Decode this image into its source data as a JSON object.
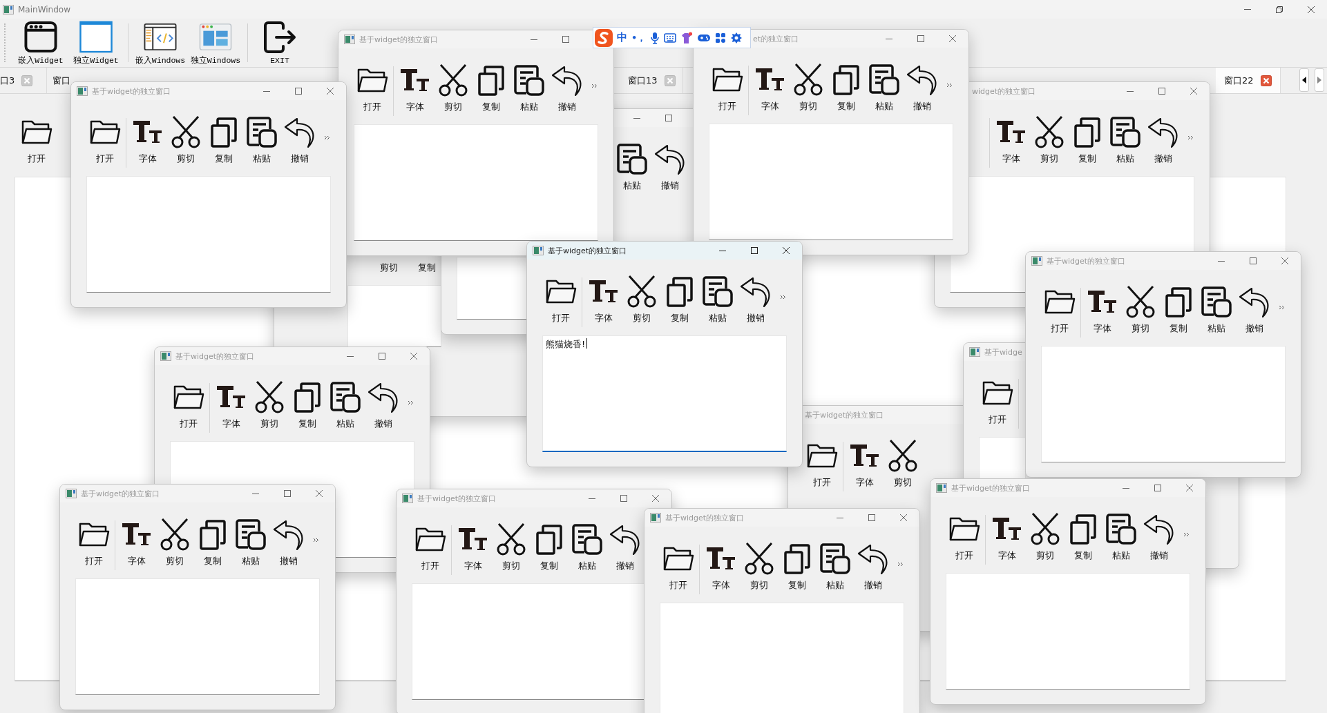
{
  "main_window": {
    "title": "MainWindow"
  },
  "toolbar": [
    {
      "kind": "embed_widget",
      "label": "嵌入Widget"
    },
    {
      "kind": "float_widget",
      "label": "独立Widget"
    },
    {
      "kind": "embed_windows",
      "label": "嵌入Windows"
    },
    {
      "kind": "float_windows",
      "label": "独立Windows"
    },
    {
      "kind": "exit",
      "label": "EXIT"
    }
  ],
  "tabs": [
    {
      "label": "口3",
      "selected": false
    },
    {
      "label": "窗口",
      "selected": false
    },
    {
      "label": "窗口13",
      "selected": false
    },
    {
      "label": "窗口22",
      "selected": true
    }
  ],
  "embedded_toolbar": [
    {
      "kind": "open",
      "label": "打开"
    }
  ],
  "windows": [
    {
      "title": "基于widget的独立窗口",
      "active": false,
      "tools": [
        {
          "kind": "open",
          "label": "打开"
        },
        {
          "kind": "font",
          "label": "字体"
        },
        {
          "kind": "cut",
          "label": "剪切"
        },
        {
          "kind": "copy",
          "label": "复制"
        },
        {
          "kind": "paste",
          "label": "粘贴"
        },
        {
          "kind": "undo",
          "label": "撤销"
        }
      ]
    },
    {
      "title": "et的独立窗口",
      "active": false,
      "tools": [
        {
          "kind": "open",
          "label": "打开"
        },
        {
          "kind": "font",
          "label": "字体"
        },
        {
          "kind": "cut",
          "label": "剪切"
        },
        {
          "kind": "copy",
          "label": "复制"
        },
        {
          "kind": "paste",
          "label": "粘贴"
        },
        {
          "kind": "undo",
          "label": "撤销"
        }
      ]
    },
    {
      "title": "基于widget的独立窗口",
      "active": false,
      "tools": [
        {
          "kind": "open",
          "label": "打开"
        },
        {
          "kind": "font",
          "label": "字体"
        },
        {
          "kind": "cut",
          "label": "剪切"
        },
        {
          "kind": "copy",
          "label": "复制"
        },
        {
          "kind": "paste",
          "label": "粘贴"
        },
        {
          "kind": "undo",
          "label": "撤销"
        }
      ]
    },
    {
      "active": false,
      "tools": [
        {
          "kind": "paste",
          "label": "粘贴"
        },
        {
          "kind": "undo",
          "label": "撤销"
        }
      ]
    },
    {
      "title": "widget的独立窗口",
      "active": false,
      "tools": [
        {
          "kind": "font",
          "label": "字体"
        },
        {
          "kind": "cut",
          "label": "剪切"
        },
        {
          "kind": "copy",
          "label": "复制"
        },
        {
          "kind": "paste",
          "label": "粘贴"
        },
        {
          "kind": "undo",
          "label": "撤销"
        }
      ]
    },
    {
      "active": false,
      "tools": [
        {
          "kind": "cut",
          "label": "剪切"
        },
        {
          "kind": "copy",
          "label": "复制"
        }
      ]
    },
    {
      "title": "基于widget的独立窗口",
      "active": true,
      "text": "熊猫烧香!",
      "tools": [
        {
          "kind": "open",
          "label": "打开"
        },
        {
          "kind": "font",
          "label": "字体"
        },
        {
          "kind": "cut",
          "label": "剪切"
        },
        {
          "kind": "copy",
          "label": "复制"
        },
        {
          "kind": "paste",
          "label": "粘贴"
        },
        {
          "kind": "undo",
          "label": "撤销"
        }
      ]
    },
    {
      "title": "基于widget的独立窗口",
      "active": false,
      "tools": [
        {
          "kind": "open",
          "label": "打开"
        },
        {
          "kind": "font",
          "label": "字体"
        },
        {
          "kind": "cut",
          "label": "剪切"
        },
        {
          "kind": "copy",
          "label": "复制"
        },
        {
          "kind": "paste",
          "label": "粘贴"
        },
        {
          "kind": "undo",
          "label": "撤销"
        }
      ]
    },
    {
      "title": "基于widget的独立窗口",
      "active": false,
      "tools": [
        {
          "kind": "open",
          "label": "打开"
        },
        {
          "kind": "font",
          "label": "字体"
        },
        {
          "kind": "cut",
          "label": "剪切"
        },
        {
          "kind": "copy",
          "label": "复制"
        },
        {
          "kind": "paste",
          "label": "粘贴"
        },
        {
          "kind": "undo",
          "label": "撤销"
        }
      ]
    },
    {
      "title": "基于widget的独立窗口",
      "active": false,
      "tools": [
        {
          "kind": "open",
          "label": "打开"
        },
        {
          "kind": "font",
          "label": "字体"
        },
        {
          "kind": "cut",
          "label": "剪切"
        }
      ]
    },
    {
      "title": "基于widge",
      "active": false,
      "tools": [
        {
          "kind": "open",
          "label": "打开"
        }
      ]
    },
    {
      "title": "基于widget的独立窗口",
      "active": false,
      "tools": [
        {
          "kind": "open",
          "label": "打开"
        },
        {
          "kind": "font",
          "label": "字体"
        },
        {
          "kind": "cut",
          "label": "剪切"
        },
        {
          "kind": "copy",
          "label": "复制"
        },
        {
          "kind": "paste",
          "label": "粘贴"
        },
        {
          "kind": "undo",
          "label": "撤销"
        }
      ]
    },
    {
      "title": "基于widget的独立窗口",
      "active": false,
      "tools": [
        {
          "kind": "open",
          "label": "打开"
        },
        {
          "kind": "font",
          "label": "字体"
        },
        {
          "kind": "cut",
          "label": "剪切"
        },
        {
          "kind": "copy",
          "label": "复制"
        },
        {
          "kind": "paste",
          "label": "粘贴"
        },
        {
          "kind": "undo",
          "label": "撤销"
        }
      ]
    },
    {
      "title": "基于widget的独立窗口",
      "active": false,
      "tools": [
        {
          "kind": "open",
          "label": "打开"
        },
        {
          "kind": "font",
          "label": "字体"
        },
        {
          "kind": "cut",
          "label": "剪切"
        },
        {
          "kind": "copy",
          "label": "复制"
        },
        {
          "kind": "paste",
          "label": "粘贴"
        },
        {
          "kind": "undo",
          "label": "撤销"
        }
      ]
    },
    {
      "title": "基于widget的独立窗口",
      "active": false,
      "tools": [
        {
          "kind": "open",
          "label": "打开"
        },
        {
          "kind": "font",
          "label": "字体"
        },
        {
          "kind": "cut",
          "label": "剪切"
        },
        {
          "kind": "copy",
          "label": "复制"
        },
        {
          "kind": "paste",
          "label": "粘贴"
        },
        {
          "kind": "undo",
          "label": "撤销"
        }
      ]
    }
  ],
  "ime_bar": {
    "mode": "中",
    "punctuation": "•，"
  }
}
